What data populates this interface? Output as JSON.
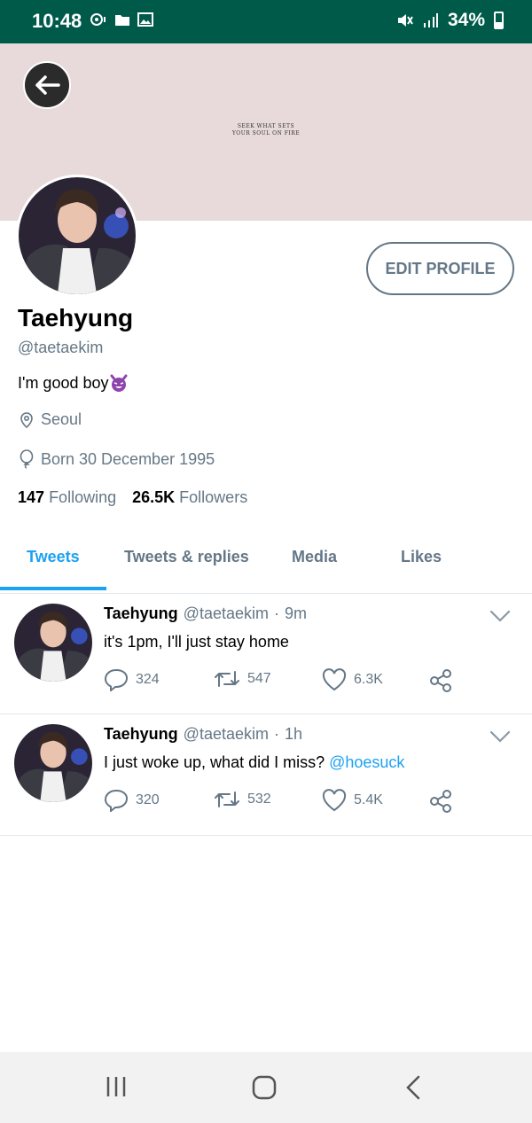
{
  "status_bar": {
    "time": "10:48",
    "battery": "34%"
  },
  "banner": {
    "quote_line1": "SEEK WHAT SETS",
    "quote_line2": "YOUR SOUL ON FIRE"
  },
  "profile": {
    "edit_button": "EDIT PROFILE",
    "name": "Taehyung",
    "handle": "@taetaekim",
    "bio": "I'm good boy",
    "bio_emoji": "devil-emoji",
    "location": "Seoul",
    "born": "Born 30 December 1995",
    "following_count": "147",
    "following_label": "Following",
    "followers_count": "26.5K",
    "followers_label": "Followers"
  },
  "tabs": [
    {
      "label": "Tweets",
      "active": true
    },
    {
      "label": "Tweets & replies",
      "active": false
    },
    {
      "label": "Media",
      "active": false
    },
    {
      "label": "Likes",
      "active": false
    }
  ],
  "tweets": [
    {
      "name": "Taehyung",
      "handle": "@taetaekim",
      "dot": "·",
      "time": "9m",
      "text": "it's 1pm, I'll just stay home",
      "mention": "",
      "replies": "324",
      "retweets": "547",
      "likes": "6.3K"
    },
    {
      "name": "Taehyung",
      "handle": "@taetaekim",
      "dot": "·",
      "time": "1h",
      "text": "I just woke up, what did I miss? ",
      "mention": "@hoesuck",
      "replies": "320",
      "retweets": "532",
      "likes": "5.4K"
    }
  ],
  "colors": {
    "status_bar": "#005a4a",
    "banner": "#e8dada",
    "accent": "#1da1f2",
    "muted": "#657786"
  }
}
